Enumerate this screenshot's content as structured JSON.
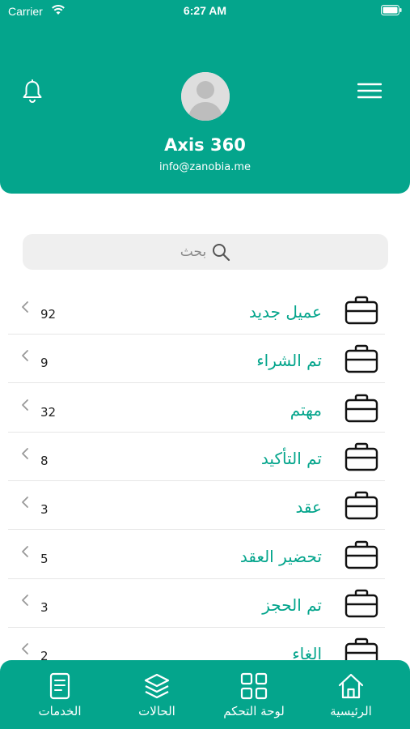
{
  "status": {
    "carrier": "Carrier",
    "time": "6:27 AM"
  },
  "profile": {
    "name": "Axis 360",
    "email": "info@zanobia.me"
  },
  "search": {
    "placeholder": "بحث"
  },
  "statuses": [
    {
      "label": "عميل جديد",
      "count": "92"
    },
    {
      "label": "تم الشراء",
      "count": "9"
    },
    {
      "label": "مهتم",
      "count": "32"
    },
    {
      "label": "تم التأكيد",
      "count": "8"
    },
    {
      "label": "عقد",
      "count": "3"
    },
    {
      "label": "تحضير العقد",
      "count": "5"
    },
    {
      "label": "تم الحجز",
      "count": "3"
    },
    {
      "label": "الغاء",
      "count": "2"
    }
  ],
  "tabs": [
    {
      "label": "الرئيسية",
      "icon": "home-icon"
    },
    {
      "label": "لوحة التحكم",
      "icon": "grid-icon"
    },
    {
      "label": "الحالات",
      "icon": "layers-icon"
    },
    {
      "label": "الخدمات",
      "icon": "document-icon"
    }
  ],
  "colors": {
    "brand": "#04a58c",
    "search_bg": "#efefef"
  }
}
